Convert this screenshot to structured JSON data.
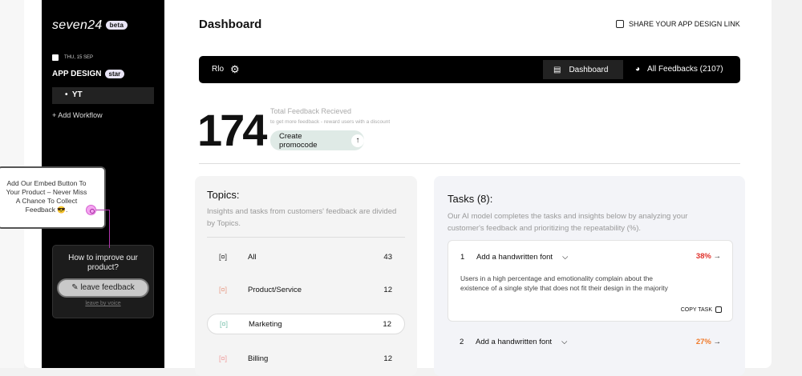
{
  "sidebar": {
    "logo": "seven24",
    "logo_badge": "beta",
    "date": "THU, 15 SEP",
    "project": "APP DESIGN",
    "project_badge": "star",
    "workflow": "YT",
    "add_workflow": "+ Add Workflow"
  },
  "tooltip": {
    "text": "Add Our Embed Button To Your Product – Never Miss A Chance To Collect Feedback 😎."
  },
  "widget": {
    "question": "How to improve our product?",
    "button": "leave feedback",
    "voice": "leave by voice"
  },
  "header": {
    "title": "Dashboard",
    "share": "SHARE YOUR APP DESIGN LINK"
  },
  "navbar": {
    "workspace": "Rlo",
    "tabs": [
      {
        "label": "Dashboard"
      },
      {
        "label": "All Feedbacks (2107)"
      }
    ]
  },
  "stats": {
    "total": "174",
    "label": "Total Feedback Recieved",
    "hint": "to get more feedback - reward users with a discount",
    "promo_button": "Create promocode"
  },
  "topics": {
    "title": "Topics:",
    "description": "Insights and tasks from customers' feedback are divided by Topics.",
    "items": [
      {
        "name": "All",
        "count": "43",
        "color": "#333333"
      },
      {
        "name": "Product/Service",
        "count": "12",
        "color": "#e8a08a"
      },
      {
        "name": "Marketing",
        "count": "12",
        "color": "#7fc4b0"
      },
      {
        "name": "Billing",
        "count": "12",
        "color": "#f0a0a0"
      }
    ]
  },
  "tasks": {
    "title": "Tasks (8):",
    "description": "Our AI model completes the tasks and insights below by analyzing your customer's feedback and prioritizing the repeatability (%).",
    "items": [
      {
        "num": "1",
        "title": "Add a handwritten font",
        "percent": "38%",
        "color": "#e0302a",
        "detail": "Users in a high percentage and emotionality complain about the existence of a single style that does not fit their design in the majority",
        "copy": "COPY TASK"
      },
      {
        "num": "2",
        "title": "Add a handwritten font",
        "percent": "27%",
        "color": "#f07a2a"
      }
    ]
  }
}
